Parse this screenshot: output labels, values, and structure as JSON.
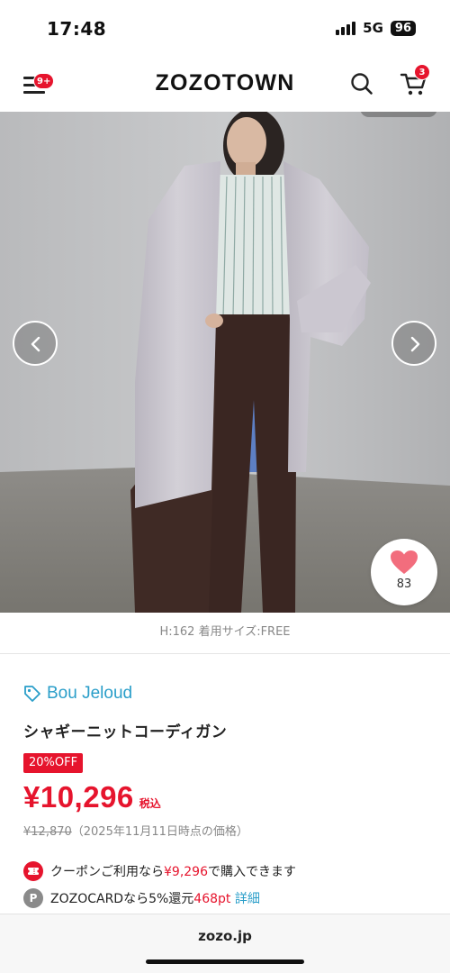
{
  "status": {
    "time": "17:48",
    "network": "5G",
    "battery": "96"
  },
  "header": {
    "logo": "ZOZOTOWN",
    "menu_badge": "9+",
    "cart_badge": "3"
  },
  "gallery": {
    "favorite_count": "83"
  },
  "size_info": "H:162 着用サイズ:FREE",
  "product": {
    "brand": "Bou Jeloud",
    "name": "シャギーニットコーディガン",
    "discount": "20%OFF",
    "price": "¥10,296",
    "tax_label": "税込",
    "original_price": "¥12,870",
    "price_note": "（2025年11月11日時点の価格）"
  },
  "coupon": {
    "prefix": "クーポンご利用なら",
    "amount": "¥9,296",
    "suffix": "で購入できます"
  },
  "zozocard": {
    "icon_letter": "P",
    "prefix": "ZOZOCARDなら5%還元",
    "points": "468pt",
    "link": "詳細"
  },
  "browser": {
    "url": "zozo.jp"
  },
  "colors": {
    "accent_red": "#e6142d",
    "brand_blue": "#2a9ec9",
    "heart_pink": "#f26d7d"
  },
  "icons": [
    "menu-icon",
    "search-icon",
    "cart-icon",
    "chevron-left-icon",
    "chevron-right-icon",
    "heart-icon",
    "tag-icon",
    "coupon-icon"
  ]
}
